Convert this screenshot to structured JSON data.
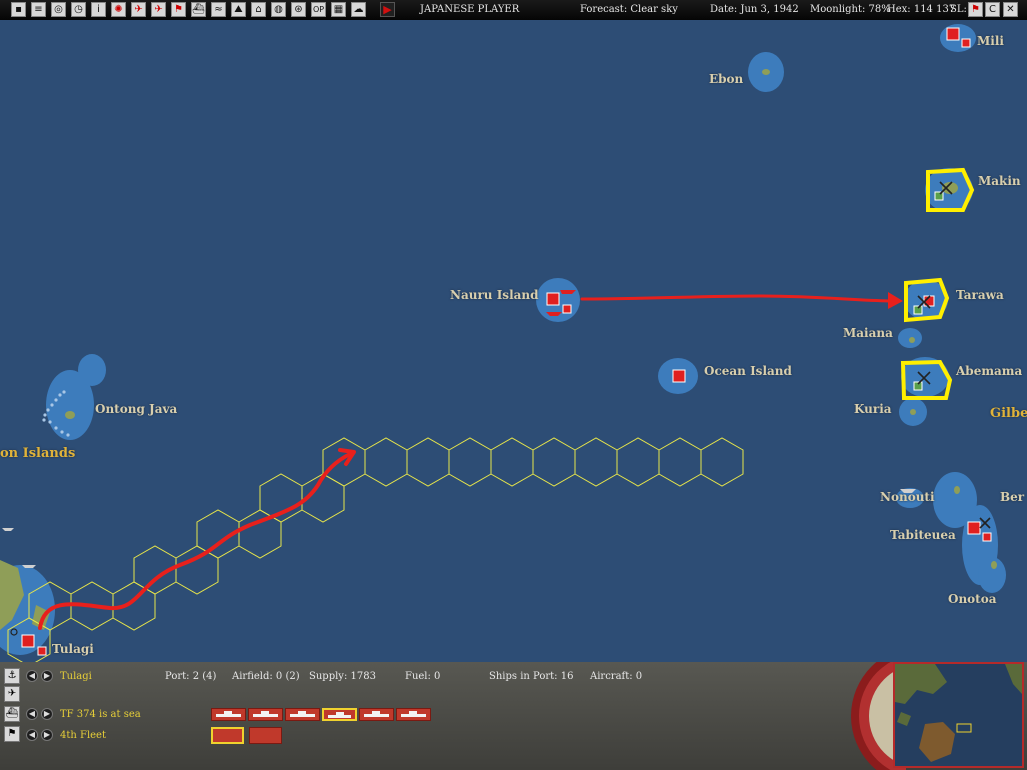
{
  "topbar": {
    "player": "JAPANESE PLAYER",
    "forecast": "Forecast: Clear sky",
    "date": "Date: Jun 3, 1942",
    "moonlight": "Moonlight: 78%",
    "hex": "Hex: 114 137",
    "sl": "SL:",
    "op_label": "OP",
    "buttons": [
      "save-icon",
      "report-icon",
      "intel-icon",
      "time-icon",
      "info-icon",
      "flag-icon",
      "aircraft-icon",
      "air-group-icon",
      "flag2-icon",
      "ship-icon",
      "convoy-icon",
      "land-icon",
      "base-icon",
      "globe-icon",
      "filter-icon",
      "op-icon",
      "map-icon",
      "weather-icon"
    ]
  },
  "map": {
    "labels": {
      "mili": "Mili",
      "ebon": "Ebon",
      "makin": "Makin",
      "tarawa": "Tarawa",
      "maiana": "Maiana",
      "abemama": "Abemama",
      "kuria": "Kuria",
      "gilbert": "Gilbe",
      "nauru": "Nauru Island",
      "ocean": "Ocean Island",
      "ontong": "Ontong Java",
      "solomon": "on Islands",
      "tulagi": "Tulagi",
      "nonouti": "Nonouti",
      "tabiteuea": "Tabiteuea",
      "beru": "Ber",
      "onotoa": "Onotoa"
    },
    "highlight_color": "#ffef00",
    "route_color": "#e8201c",
    "hex_color": "#e8e64a"
  },
  "panel": {
    "base_name": "Tulagi",
    "port": "Port: 2 (4)",
    "airfield": "Airfield: 0 (2)",
    "supply": "Supply: 1783",
    "fuel": "Fuel: 0",
    "ships_in_port": "Ships in Port: 16",
    "aircraft": "Aircraft: 0",
    "tf_status": "TF 374 is at sea",
    "fleet": "4th Fleet",
    "selected_ship_index": 3,
    "ship_count": 6
  }
}
